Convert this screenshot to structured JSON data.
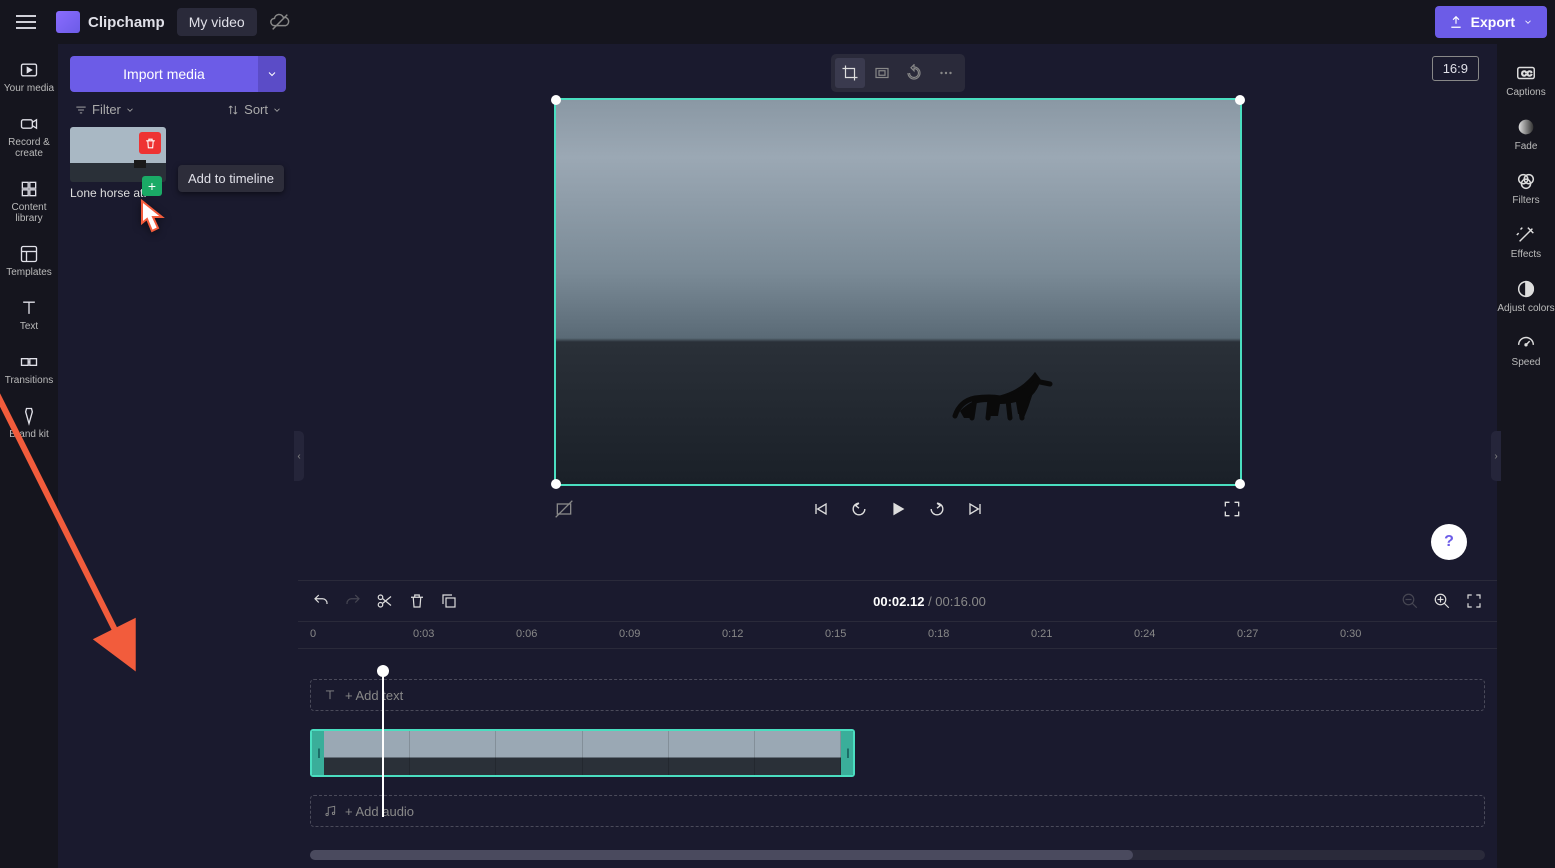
{
  "topbar": {
    "app_name": "Clipchamp",
    "project_title": "My video",
    "export_label": "Export"
  },
  "leftrail": [
    {
      "key": "your-media",
      "label": "Your media"
    },
    {
      "key": "record-create",
      "label": "Record & create"
    },
    {
      "key": "content-library",
      "label": "Content library"
    },
    {
      "key": "templates",
      "label": "Templates"
    },
    {
      "key": "text",
      "label": "Text"
    },
    {
      "key": "transitions",
      "label": "Transitions"
    },
    {
      "key": "brand-kit",
      "label": "Brand kit"
    }
  ],
  "media_panel": {
    "import_label": "Import media",
    "filter_label": "Filter",
    "sort_label": "Sort",
    "items": [
      {
        "name": "Lone horse at."
      }
    ],
    "tooltip": "Add to timeline"
  },
  "preview": {
    "aspect_ratio": "16:9"
  },
  "timeline": {
    "current_time": "00:02.12",
    "total_time": "00:16.00",
    "ruler_ticks": [
      "0",
      "0:03",
      "0:06",
      "0:09",
      "0:12",
      "0:15",
      "0:18",
      "0:21",
      "0:24",
      "0:27",
      "0:30"
    ],
    "add_text_label": "+ Add text",
    "add_audio_label": "+ Add audio"
  },
  "rightrail": [
    {
      "key": "captions",
      "label": "Captions"
    },
    {
      "key": "fade",
      "label": "Fade"
    },
    {
      "key": "filters",
      "label": "Filters"
    },
    {
      "key": "effects",
      "label": "Effects"
    },
    {
      "key": "adjust-colors",
      "label": "Adjust colors"
    },
    {
      "key": "speed",
      "label": "Speed"
    }
  ],
  "help_fab": "?"
}
